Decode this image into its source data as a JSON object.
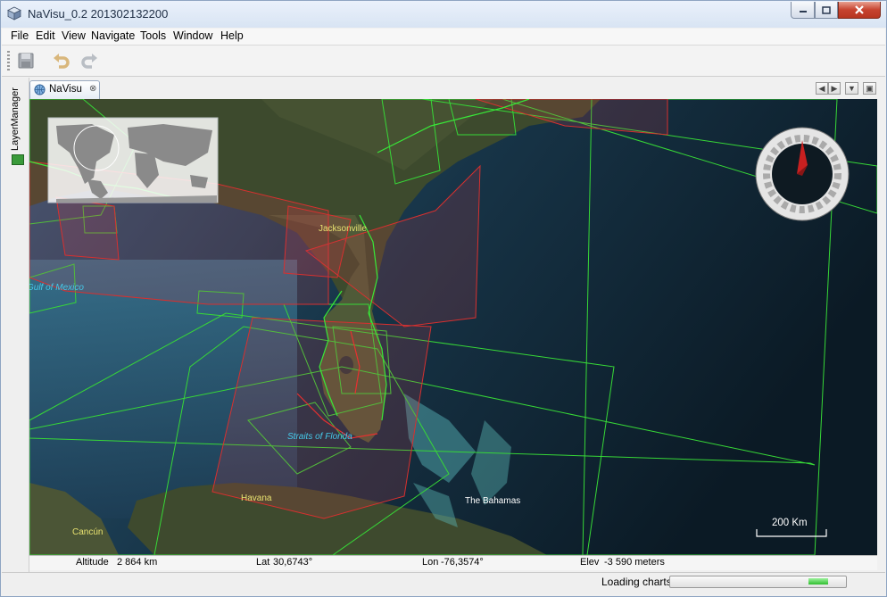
{
  "window": {
    "title": "NaVisu_0.2 201302132200"
  },
  "menubar": {
    "items": [
      "File",
      "Edit",
      "View",
      "Navigate",
      "Tools",
      "Window",
      "Help"
    ]
  },
  "toolbar": {
    "buttons": [
      "save-icon",
      "undo-icon",
      "redo-icon"
    ]
  },
  "side_panel": {
    "label": "LayerManager"
  },
  "tab": {
    "label": "NaVisu"
  },
  "map": {
    "places": [
      "Jacksonville",
      "Gulf of Mexico",
      "Straits of Florida",
      "Havana",
      "The Bahamas",
      "Cancún"
    ],
    "scale_label": "200 Km",
    "colors": {
      "chart_outline_green": "#37d837",
      "chart_outline_red": "#d8302f",
      "ocean": "#0f2230",
      "land": "#3c4a2c"
    }
  },
  "coordinates": {
    "altitude_label": "Altitude",
    "altitude_value": "2 864 km",
    "lat_label": "Lat",
    "lat_value": "30,6743°",
    "lon_label": "Lon",
    "lon_value": "-76,3574°",
    "elev_label": "Elev",
    "elev_value": "-3 590 meters"
  },
  "status": {
    "text": "Loading charts"
  }
}
